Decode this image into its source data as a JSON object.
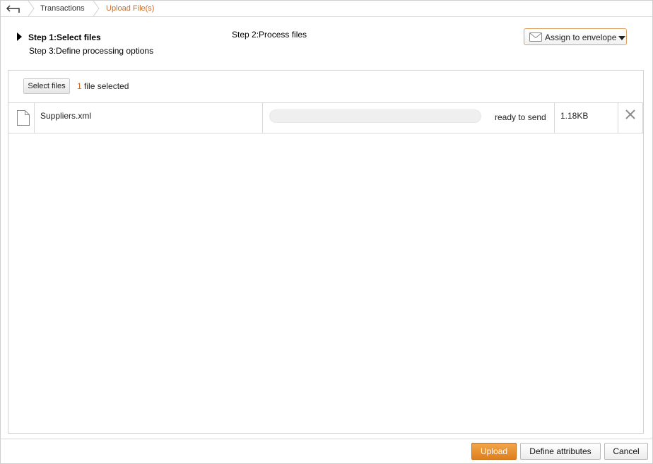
{
  "breadcrumb": {
    "items": [
      "Transactions",
      "Upload File(s)"
    ]
  },
  "steps": {
    "step1": "Step 1:Select files",
    "step2": "Step 2:Process files",
    "step3": "Step 3:Define processing options"
  },
  "envelope_button": {
    "label": "Assign to envelope",
    "icon": "envelope-icon"
  },
  "select": {
    "button_label": "Select files",
    "count": "1",
    "count_suffix": " file selected"
  },
  "files": [
    {
      "name": "Suppliers.xml",
      "status": "ready to send",
      "size": "1.18KB",
      "progress": 0,
      "icon": "file-icon"
    }
  ],
  "footer": {
    "upload_label": "Upload",
    "define_label": "Define attributes",
    "cancel_label": "Cancel"
  },
  "colors": {
    "accent": "#d2691e",
    "upload_button": "#e88e2c",
    "border": "#d2d2d2"
  }
}
